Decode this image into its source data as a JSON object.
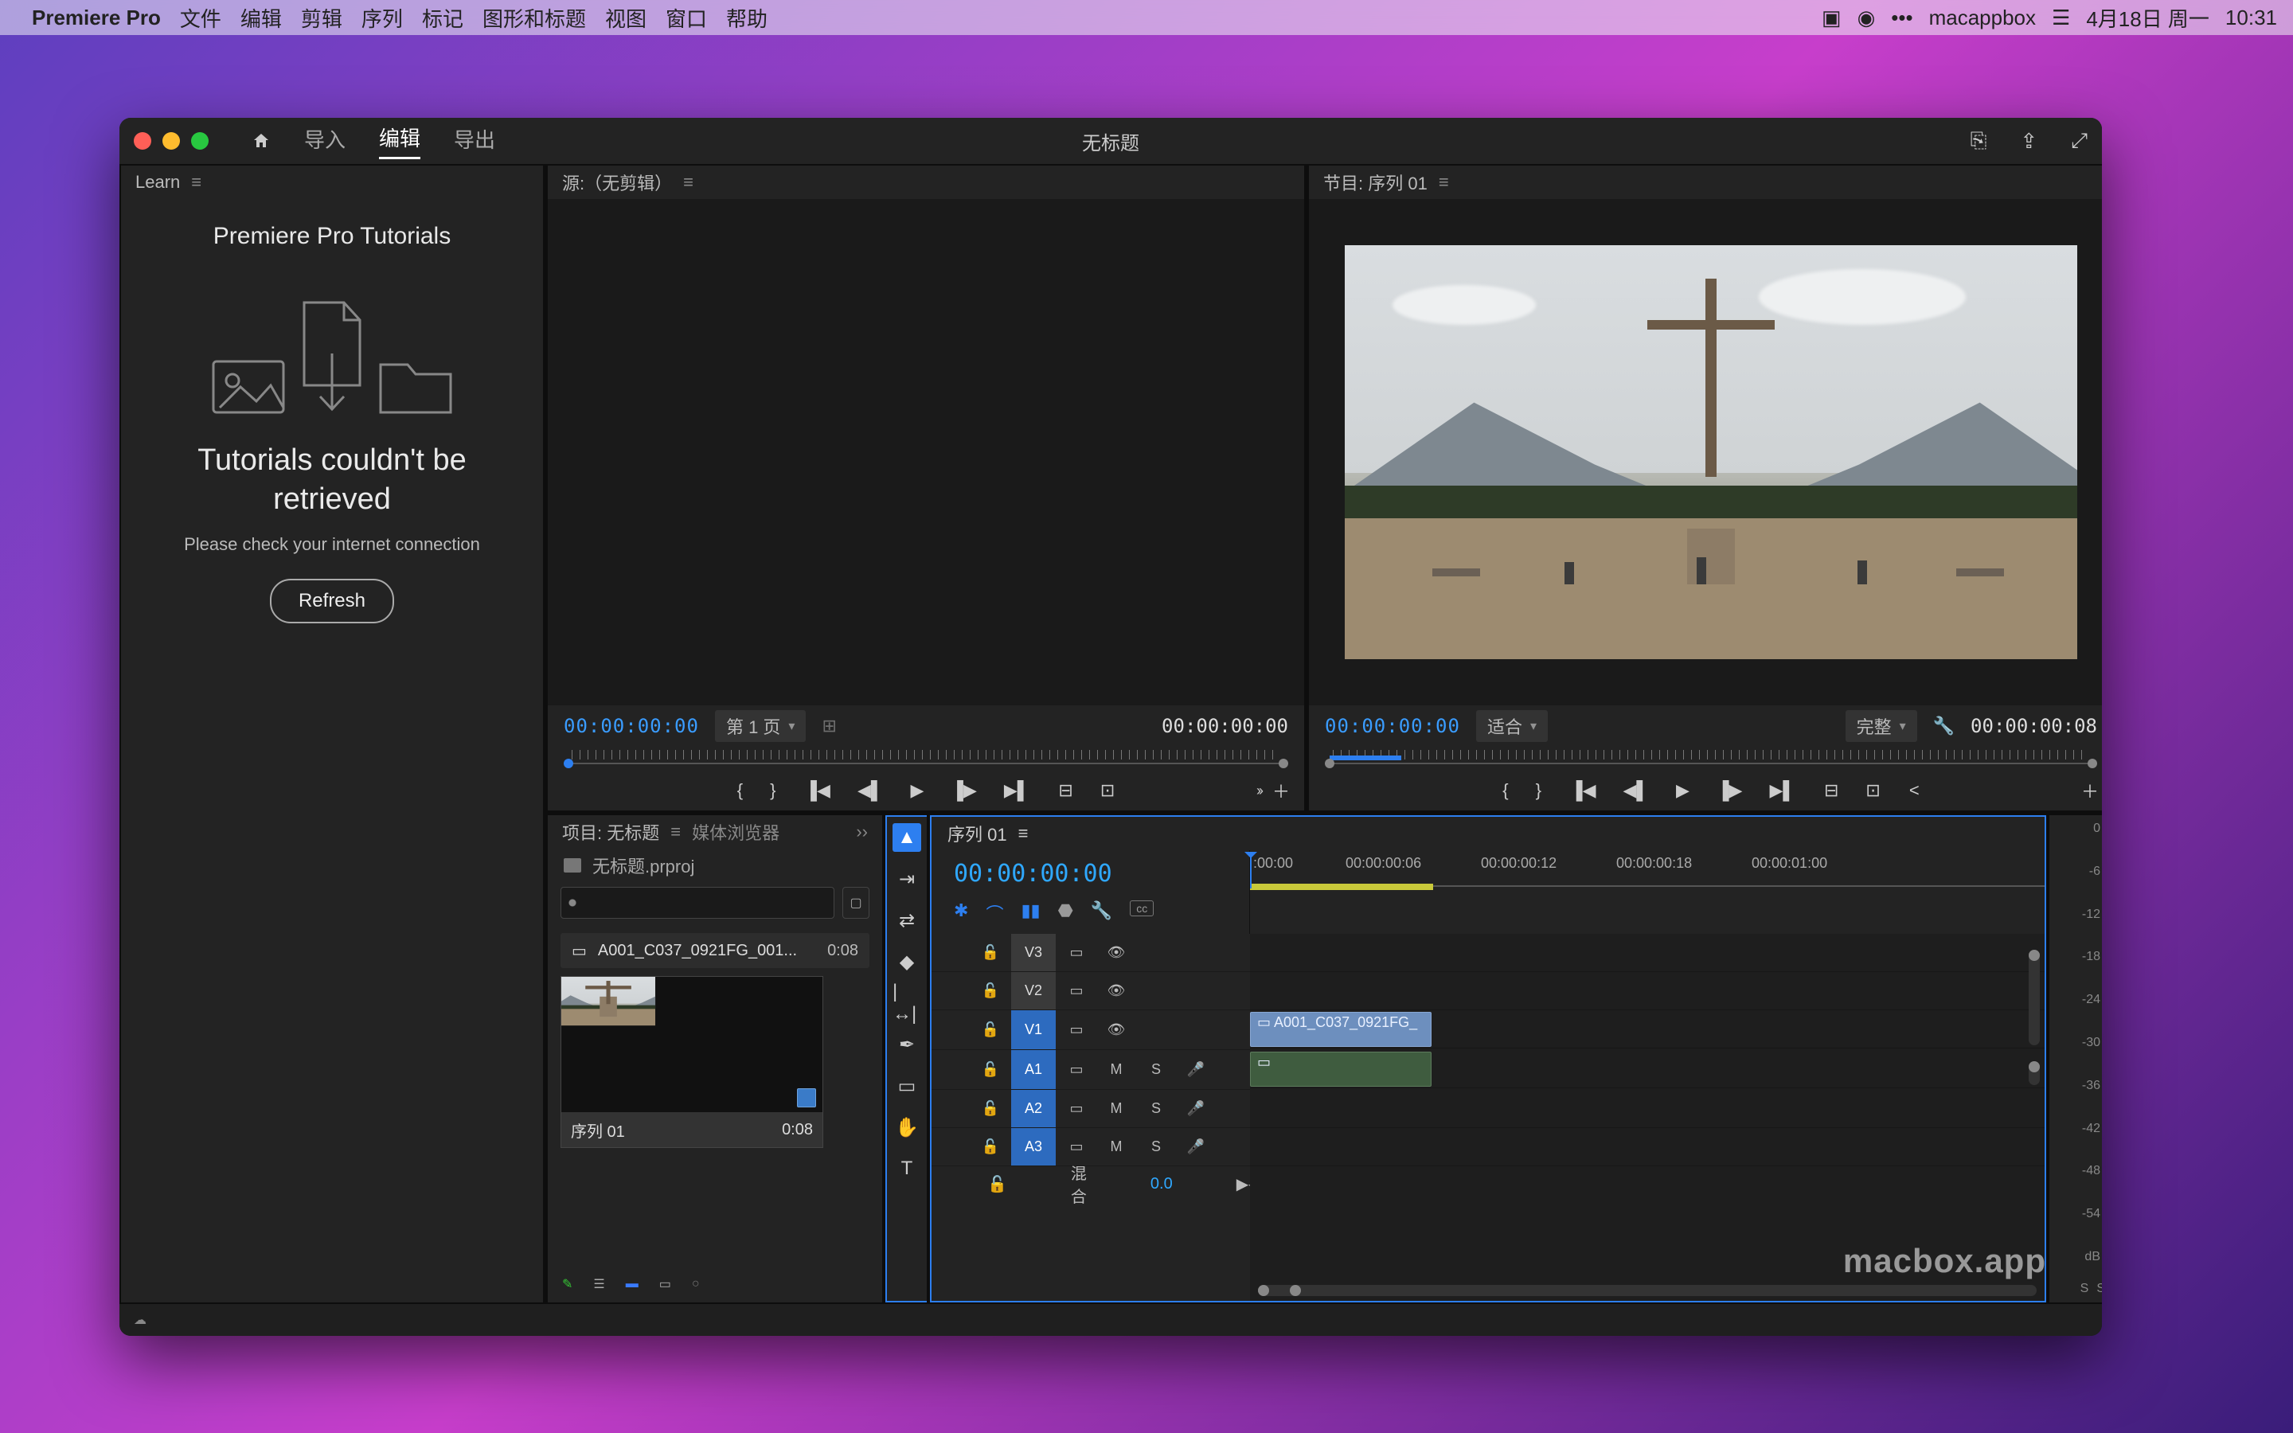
{
  "menubar": {
    "app": "Premiere Pro",
    "items": [
      "文件",
      "编辑",
      "剪辑",
      "序列",
      "标记",
      "图形和标题",
      "视图",
      "窗口",
      "帮助"
    ],
    "right": {
      "account": "macappbox",
      "date": "4月18日 周一",
      "time": "10:31"
    }
  },
  "window": {
    "tabs": [
      "导入",
      "编辑",
      "导出"
    ],
    "activeTab": 1,
    "title": "无标题"
  },
  "learn": {
    "tab": "Learn",
    "title": "Premiere Pro Tutorials",
    "heading": "Tutorials couldn't be retrieved",
    "sub": "Please check your internet connection",
    "refresh": "Refresh"
  },
  "source": {
    "tab": "源:（无剪辑）",
    "tc_in": "00:00:00:00",
    "page": "第 1 页",
    "tc_out": "00:00:00:00"
  },
  "program": {
    "tab": "节目: 序列 01",
    "tc_in": "00:00:00:00",
    "fit": "适合",
    "quality": "完整",
    "tc_out": "00:00:00:08"
  },
  "project": {
    "tab": "项目: 无标题",
    "tab2": "媒体浏览器",
    "file": "无标题.prproj",
    "clip_name": "A001_C037_0921FG_001...",
    "clip_dur": "0:08",
    "seq_name": "序列 01",
    "seq_dur": "0:08"
  },
  "timeline": {
    "tab": "序列 01",
    "tc": "00:00:00:00",
    "ruler": [
      ":00:00",
      "00:00:00:06",
      "00:00:00:12",
      "00:00:00:18",
      "00:00:01:00"
    ],
    "video_tracks": [
      "V3",
      "V2",
      "V1"
    ],
    "audio_tracks": [
      "A1",
      "A2",
      "A3"
    ],
    "mix_label": "混合",
    "mix_value": "0.0",
    "clip_label": "A001_C037_0921FG_"
  },
  "meters": {
    "scale": [
      "0",
      "-6",
      "-12",
      "-18",
      "-24",
      "-30",
      "-36",
      "-42",
      "-48",
      "-54",
      "dB"
    ],
    "solo": "S",
    "solo2": "S"
  },
  "tools": [
    "selection",
    "track-select",
    "ripple",
    "razor",
    "slip",
    "pen",
    "rect",
    "hand",
    "type"
  ],
  "watermark": "macbox.app"
}
